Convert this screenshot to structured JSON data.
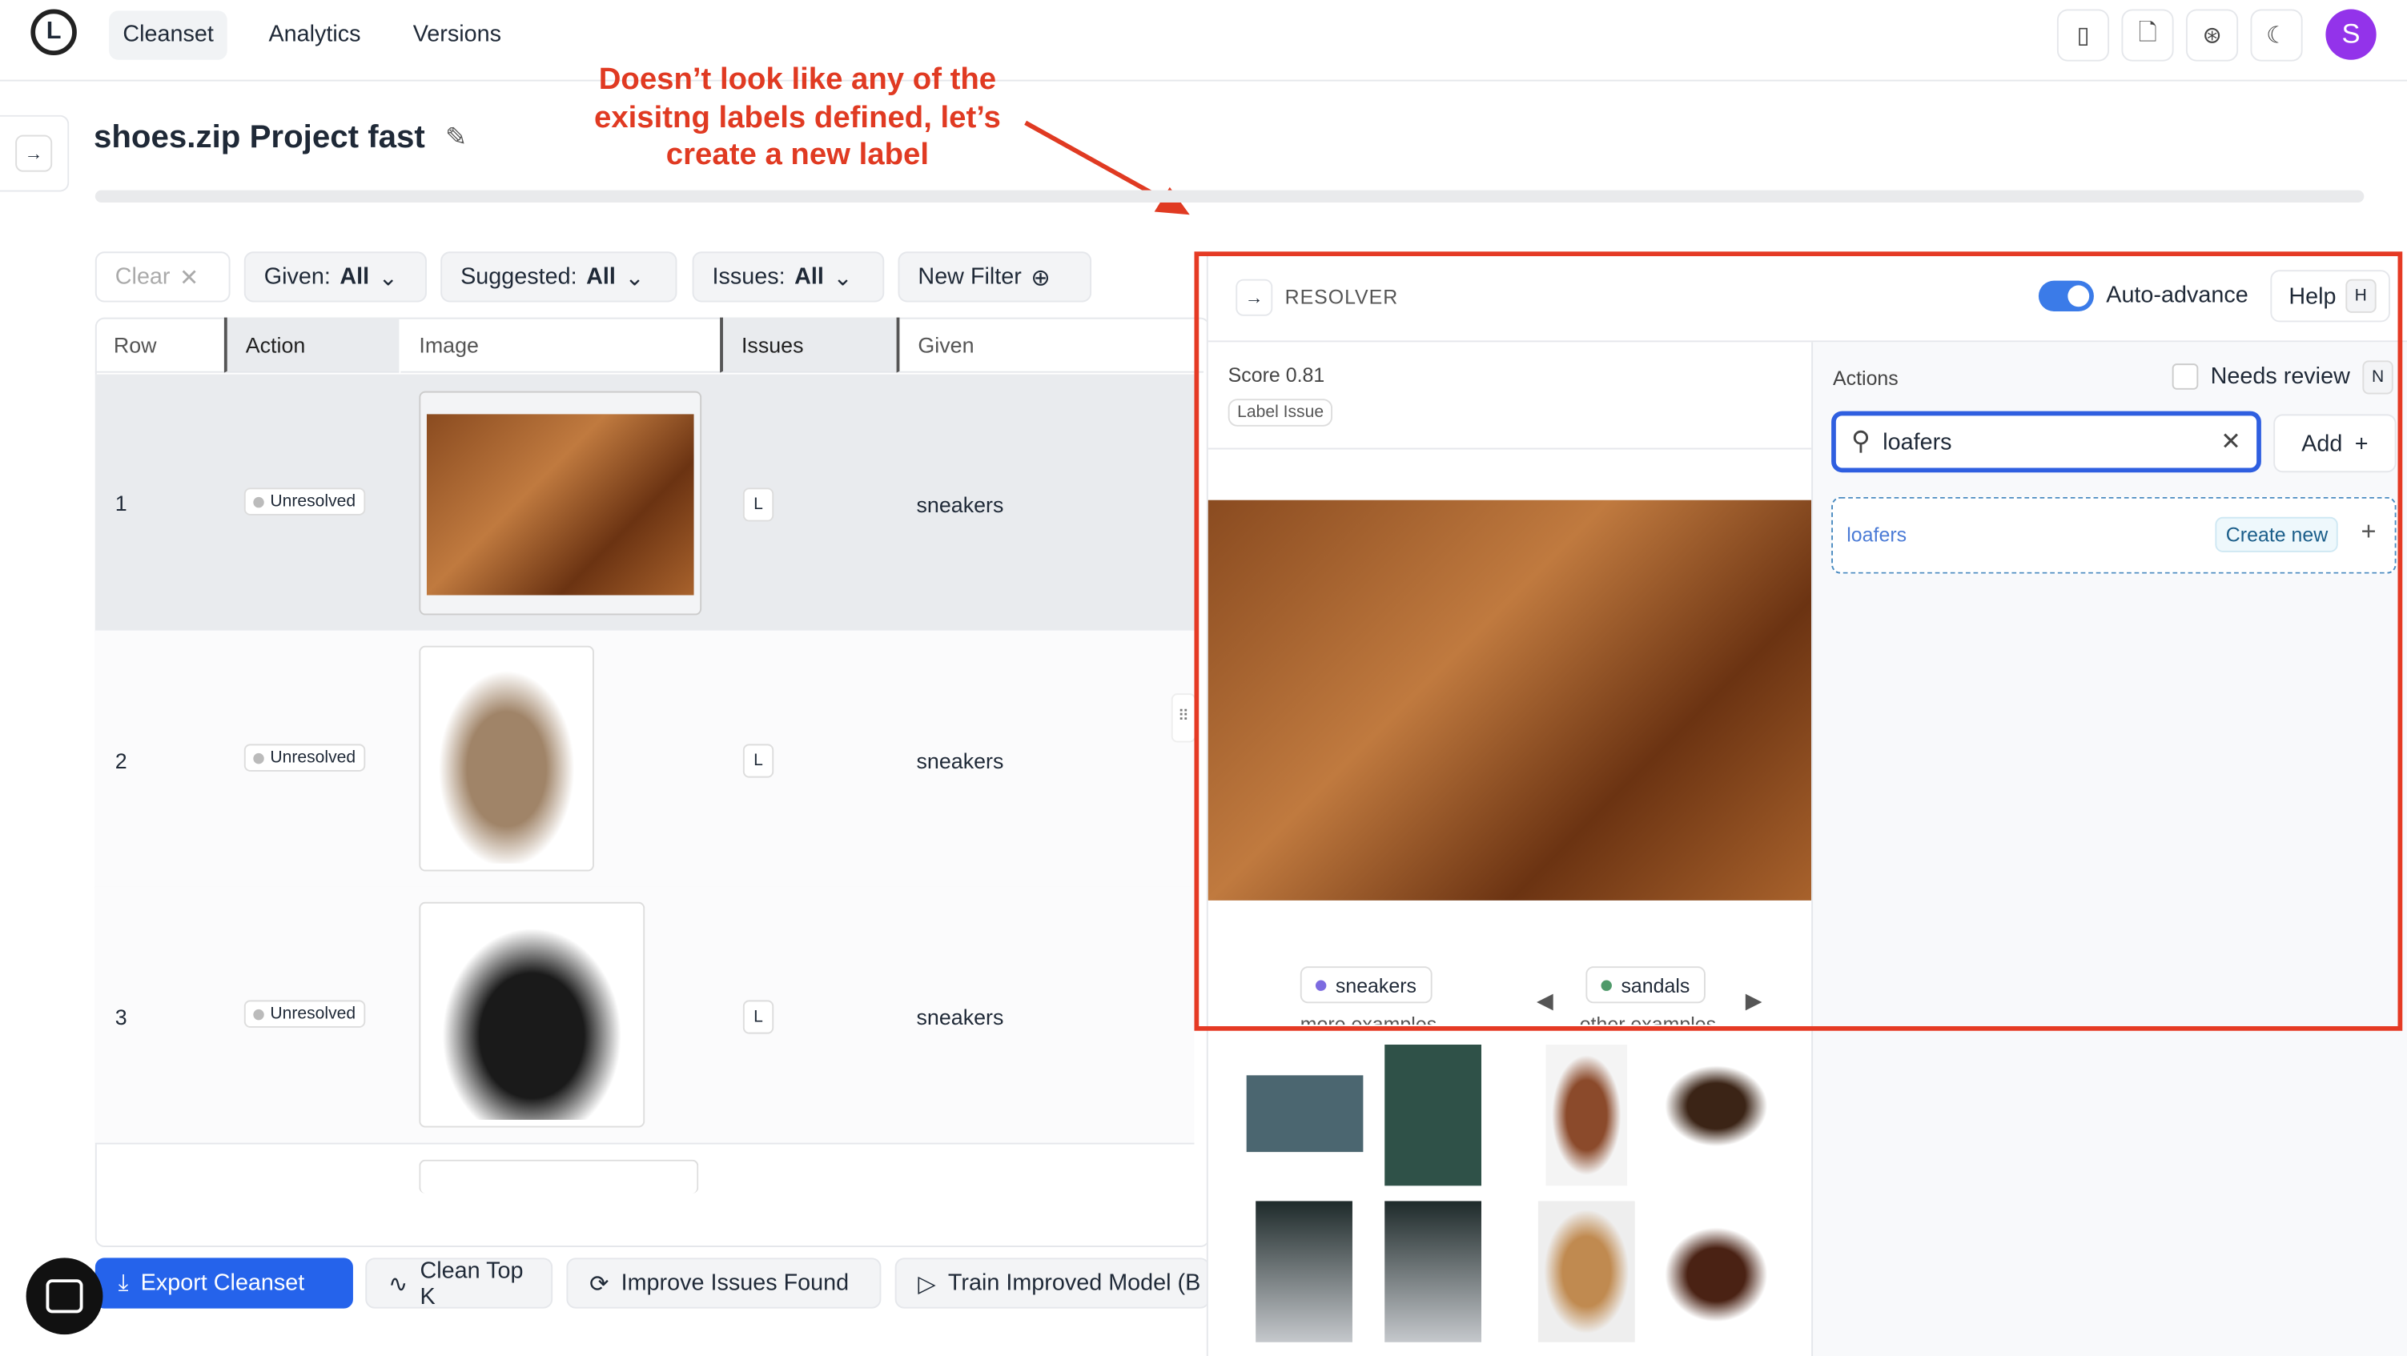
{
  "nav": {
    "tabs": [
      "Cleanset",
      "Analytics",
      "Versions"
    ],
    "active": "Cleanset",
    "avatar_letter": "S"
  },
  "annotation": "Doesn’t look like any of the exisitng labels defined, let’s create a new label",
  "project": {
    "title": "shoes.zip Project fast"
  },
  "filters": {
    "clear": "Clear",
    "given_label": "Given:",
    "given_value": "All",
    "suggested_label": "Suggested:",
    "suggested_value": "All",
    "issues_label": "Issues:",
    "issues_value": "All",
    "new_filter": "New Filter"
  },
  "table": {
    "columns": [
      "Row",
      "Action",
      "Image",
      "Issues",
      "Given"
    ],
    "rows": [
      {
        "row": "1",
        "action": "Unresolved",
        "issue": "L",
        "given": "sneakers"
      },
      {
        "row": "2",
        "action": "Unresolved",
        "issue": "L",
        "given": "sneakers"
      },
      {
        "row": "3",
        "action": "Unresolved",
        "issue": "L",
        "given": "sneakers"
      }
    ]
  },
  "bottom": {
    "export": "Export Cleanset",
    "clean_top_k": "Clean Top K",
    "improve": "Improve Issues Found",
    "train": "Train Improved Model (B"
  },
  "resolver": {
    "title": "RESOLVER",
    "auto_advance": "Auto-advance",
    "auto_advance_on": true,
    "help": "Help",
    "help_key": "H",
    "score": "Score 0.81",
    "issue_badge": "Label Issue",
    "actions": "Actions",
    "needs_review": "Needs review",
    "needs_review_key": "N",
    "search_value": "loafers",
    "add": "Add",
    "suggestion": "loafers",
    "create_new": "Create new",
    "given_chip": "sneakers",
    "given_more": "more examples",
    "other_chip": "sandals",
    "other_more": "other examples"
  },
  "colors": {
    "accent": "#2563eb",
    "annotation": "#e03a22",
    "sneakers_dot": "#7c6be0",
    "sandals_dot": "#4f9a6a"
  }
}
